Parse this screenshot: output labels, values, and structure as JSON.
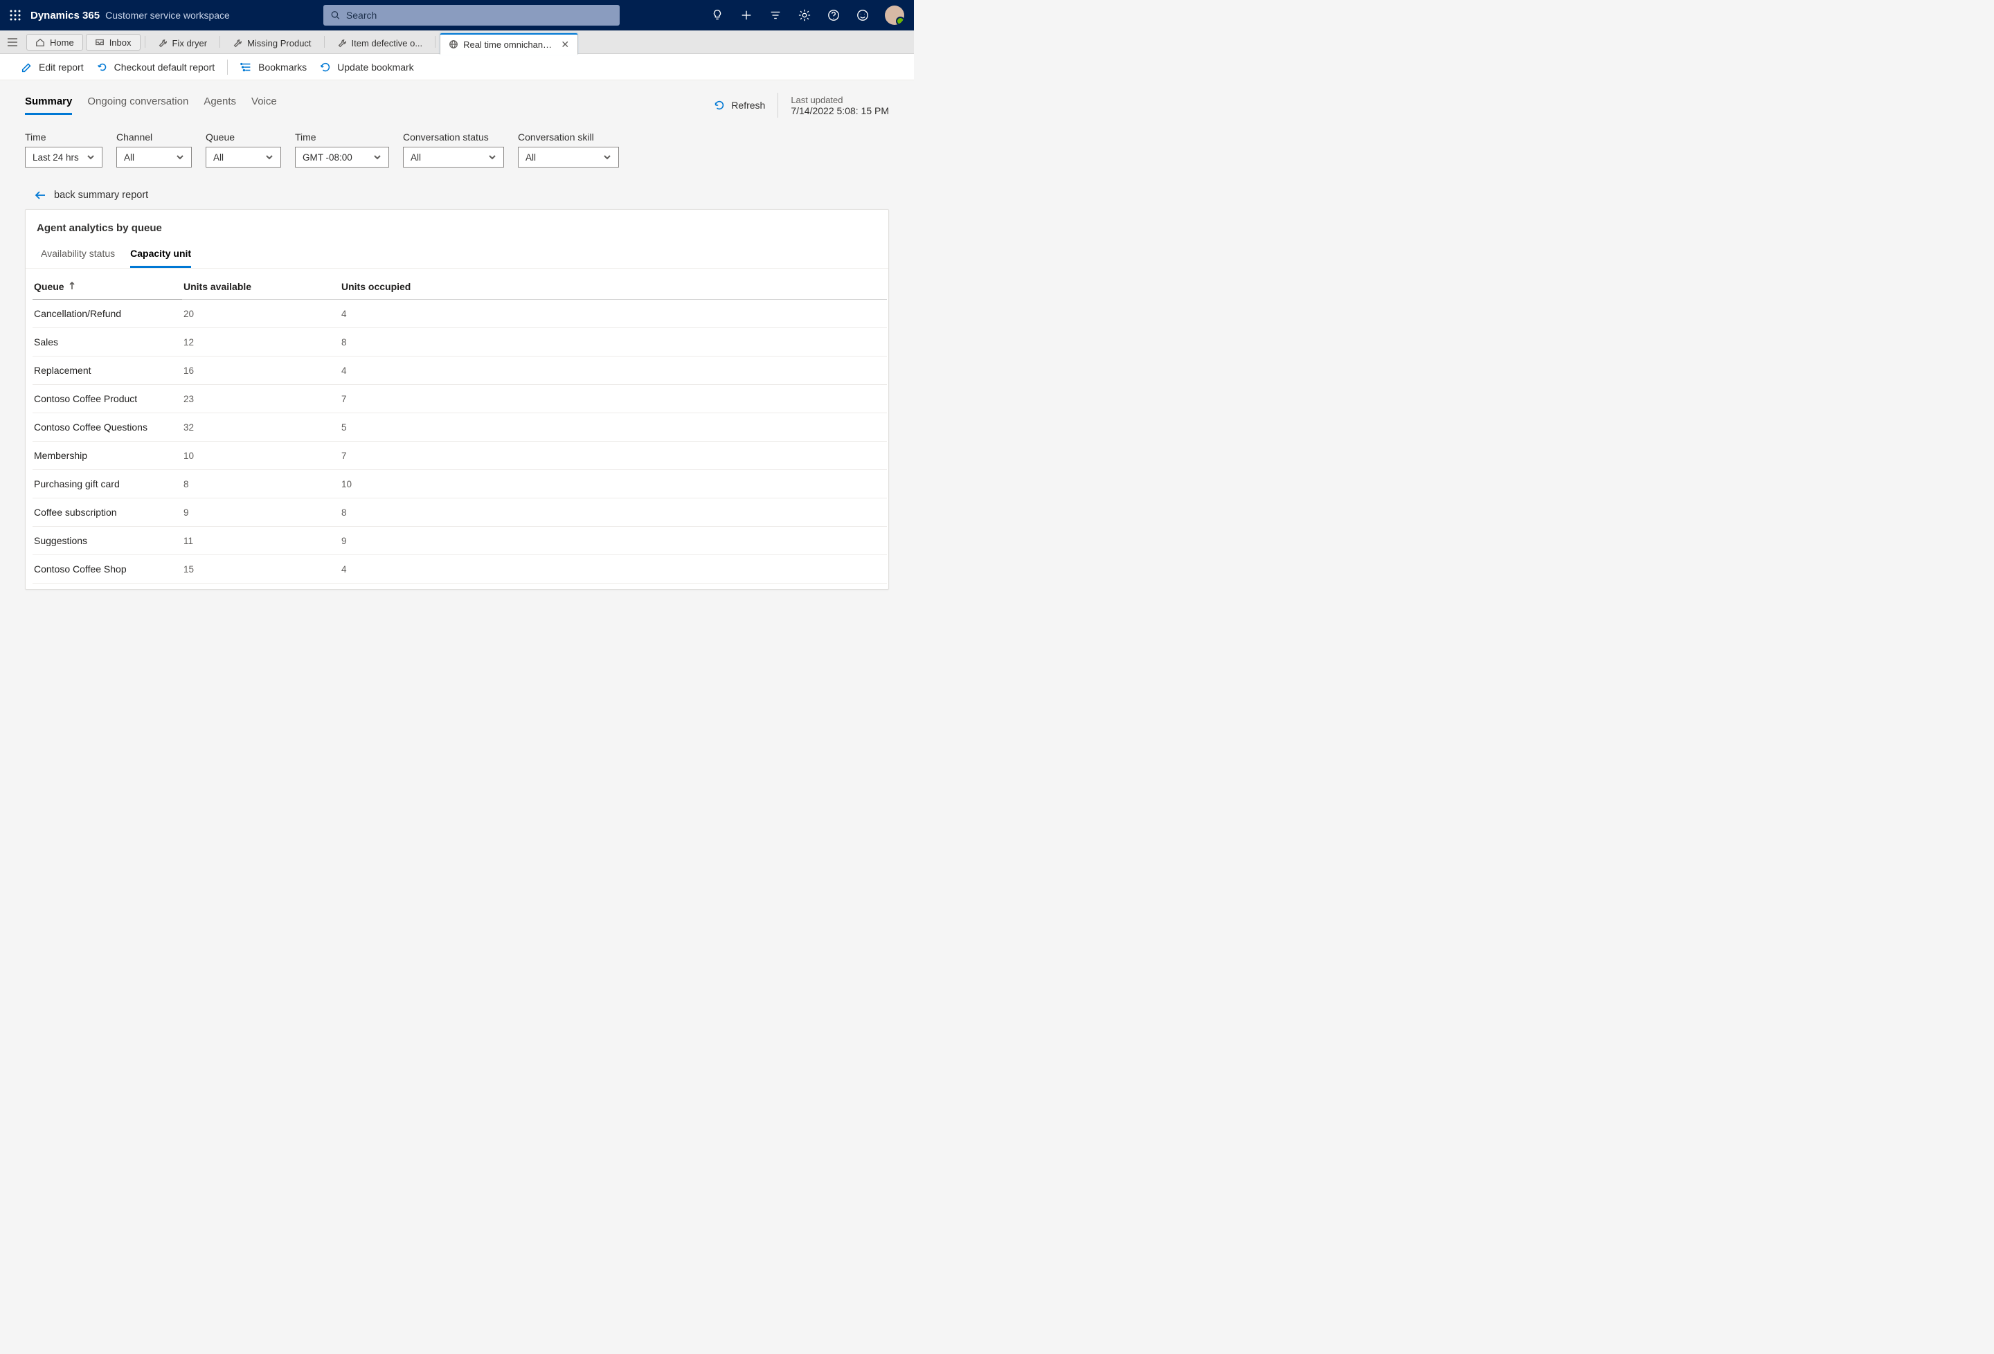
{
  "header": {
    "brand": "Dynamics 365",
    "workspace": "Customer service workspace",
    "search_placeholder": "Search"
  },
  "tabs": {
    "home": "Home",
    "inbox": "Inbox",
    "items": [
      "Fix dryer",
      "Missing Product",
      "Item defective o..."
    ],
    "active": "Real time omnichannel an..."
  },
  "commands": {
    "edit": "Edit report",
    "checkout": "Checkout default report",
    "bookmarks": "Bookmarks",
    "update": "Update bookmark"
  },
  "viewtabs": [
    "Summary",
    "Ongoing conversation",
    "Agents",
    "Voice"
  ],
  "refresh_label": "Refresh",
  "last_updated": {
    "label": "Last updated",
    "value": "7/14/2022 5:08: 15 PM"
  },
  "filters": {
    "time": {
      "label": "Time",
      "value": "Last 24 hrs"
    },
    "channel": {
      "label": "Channel",
      "value": "All"
    },
    "queue": {
      "label": "Queue",
      "value": "All"
    },
    "tz": {
      "label": "Time",
      "value": "GMT -08:00"
    },
    "status": {
      "label": "Conversation status",
      "value": "All"
    },
    "skill": {
      "label": "Conversation skill",
      "value": "All"
    }
  },
  "back_label": "back summary report",
  "card": {
    "title": "Agent analytics by queue",
    "subtabs": [
      "Availability status",
      "Capacity unit"
    ],
    "columns": [
      "Queue",
      "Units available",
      "Units occupied"
    ],
    "rows": [
      {
        "q": "Cancellation/Refund",
        "a": "20",
        "o": "4"
      },
      {
        "q": "Sales",
        "a": "12",
        "o": "8"
      },
      {
        "q": "Replacement",
        "a": "16",
        "o": "4"
      },
      {
        "q": "Contoso Coffee Product",
        "a": "23",
        "o": "7"
      },
      {
        "q": "Contoso Coffee Questions",
        "a": "32",
        "o": "5"
      },
      {
        "q": "Membership",
        "a": "10",
        "o": "7"
      },
      {
        "q": "Purchasing gift card",
        "a": "8",
        "o": "10"
      },
      {
        "q": "Coffee subscription",
        "a": "9",
        "o": "8"
      },
      {
        "q": "Suggestions",
        "a": "11",
        "o": "9"
      },
      {
        "q": "Contoso Coffee Shop",
        "a": "15",
        "o": "4"
      }
    ]
  }
}
